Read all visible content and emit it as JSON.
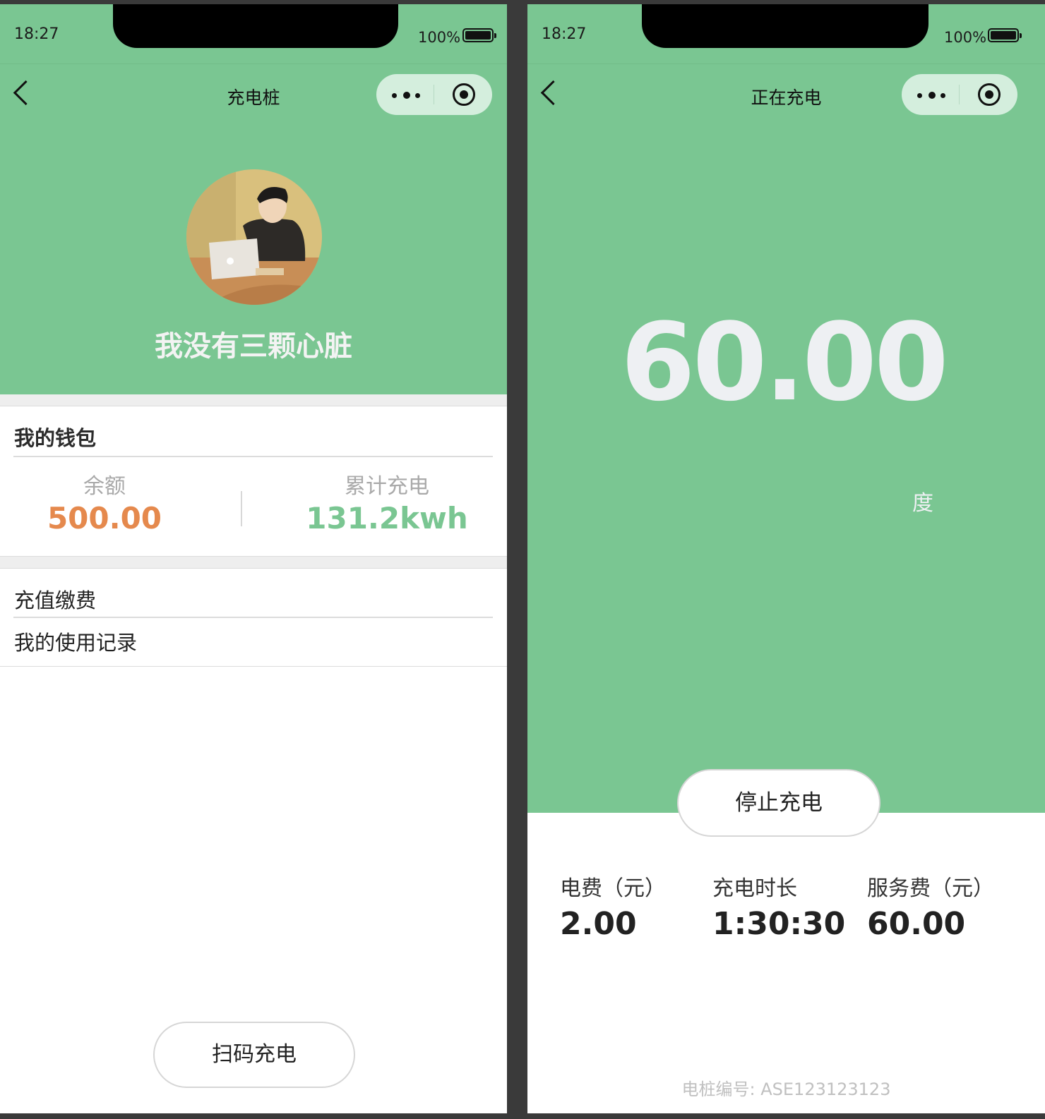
{
  "colors": {
    "brand_green": "#7ac692",
    "balance_orange": "#e5894d",
    "total_green": "#7ac692"
  },
  "left_screen": {
    "status": {
      "time": "18:27",
      "battery": "100%"
    },
    "nav": {
      "title": "充电桩",
      "more_icon": "more-dots-icon",
      "close_icon": "target-icon"
    },
    "profile": {
      "username": "我没有三颗心脏"
    },
    "wallet": {
      "title": "我的钱包",
      "balance_label": "余额",
      "balance_value": "500.00",
      "total_label": "累计充电",
      "total_value": "131.2kwh"
    },
    "menu": {
      "recharge": "充值缴费",
      "records": "我的使用记录"
    },
    "scan_button": "扫码充电"
  },
  "right_screen": {
    "status": {
      "time": "18:27",
      "battery": "100%"
    },
    "nav": {
      "title": "正在充电"
    },
    "reading": {
      "value": "60.00",
      "unit": "度"
    },
    "stop_button": "停止充电",
    "stats": [
      {
        "label": "电费（元）",
        "value": "2.00"
      },
      {
        "label": "充电时长",
        "value": "1:30:30"
      },
      {
        "label": "服务费（元）",
        "value": "60.00"
      }
    ],
    "pile_id": "电桩编号: ASE123123123"
  }
}
